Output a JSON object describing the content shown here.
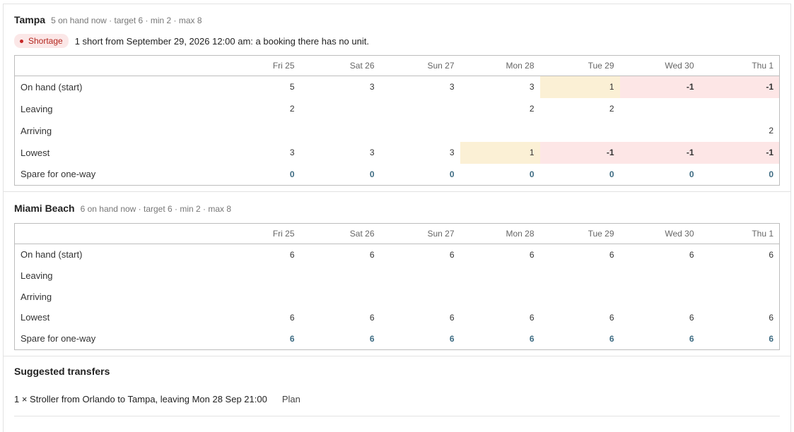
{
  "tampa": {
    "name": "Tampa",
    "meta": "5 on hand now · target 6 · min 2 · max 8",
    "badge": "Shortage",
    "alert": "1 short from September 29, 2026 12:00 am: a booking there has no unit.",
    "days": [
      "Fri 25",
      "Sat 26",
      "Sun 27",
      "Mon 28",
      "Tue 29",
      "Wed 30",
      "Thu 1"
    ],
    "rows": [
      {
        "label": "On hand (start)",
        "cells": [
          "5",
          "3",
          "3",
          "3",
          "1",
          "-1",
          "-1"
        ]
      },
      {
        "label": "Leaving",
        "cells": [
          "2",
          "",
          "",
          "2",
          "2",
          "",
          ""
        ]
      },
      {
        "label": "Arriving",
        "cells": [
          "",
          "",
          "",
          "",
          "",
          "",
          "2"
        ]
      },
      {
        "label": "Lowest",
        "cells": [
          "3",
          "3",
          "3",
          "1",
          "-1",
          "-1",
          "-1"
        ]
      },
      {
        "label": "Spare for one-way",
        "cells": [
          "0",
          "0",
          "0",
          "0",
          "0",
          "0",
          "0"
        ]
      }
    ]
  },
  "miami": {
    "name": "Miami Beach",
    "meta": "6 on hand now · target 6 · min 2 · max 8",
    "days": [
      "Fri 25",
      "Sat 26",
      "Sun 27",
      "Mon 28",
      "Tue 29",
      "Wed 30",
      "Thu 1"
    ],
    "rows": [
      {
        "label": "On hand (start)",
        "cells": [
          "6",
          "6",
          "6",
          "6",
          "6",
          "6",
          "6"
        ]
      },
      {
        "label": "Leaving",
        "cells": [
          "",
          "",
          "",
          "",
          "",
          "",
          ""
        ]
      },
      {
        "label": "Arriving",
        "cells": [
          "",
          "",
          "",
          "",
          "",
          "",
          ""
        ]
      },
      {
        "label": "Lowest",
        "cells": [
          "6",
          "6",
          "6",
          "6",
          "6",
          "6",
          "6"
        ]
      },
      {
        "label": "Spare for one-way",
        "cells": [
          "6",
          "6",
          "6",
          "6",
          "6",
          "6",
          "6"
        ]
      }
    ]
  },
  "suggestions": {
    "title": "Suggested transfers",
    "items": [
      {
        "text": "1 × Stroller from Orlando to Tampa, leaving Mon 28 Sep 21:00",
        "action": "Plan"
      }
    ]
  },
  "colors": {
    "shortage": "#b3261e",
    "warning_bg": "#fbf0d5",
    "negative_bg": "#fde6e6",
    "spare": "#3d6b82"
  }
}
